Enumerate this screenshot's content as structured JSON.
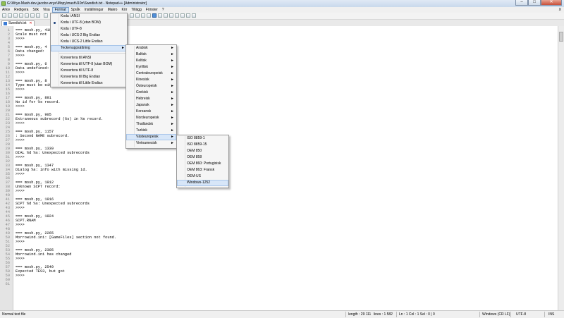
{
  "window": {
    "title": "G:\\Wrye-Mash-dev-jacobv-wrye\\Mopy\\mash\\l10n\\Swedish.txt - Notepad++ [Administrator]"
  },
  "menubar": [
    "Arkiv",
    "Redigera",
    "Sök",
    "Visa",
    "Format",
    "Språk",
    "Inställningar",
    "Makro",
    "Kör",
    "Tillägg",
    "Fönster",
    "?"
  ],
  "menubar_close": "X",
  "tab": {
    "label": "Swedish.txt"
  },
  "format_menu": {
    "items": [
      "Koda i ANSI",
      "Koda i UTF-8 (utan BOM)",
      "Koda i UTF-8",
      "Koda i UCS-2 Big Endian",
      "Koda i UCS-2 Little Endian"
    ],
    "selected_index": 1,
    "submenu_item": "Teckenuppsättning",
    "convert_items": [
      "Konvertera till ANSI",
      "Konvertera till UTF-8 (utan BOM)",
      "Konvertera till UTF-8",
      "Konvertera till Big Endian",
      "Konvertera till Little Endian"
    ]
  },
  "charset_menu": {
    "items": [
      "Arabisk",
      "Baltisk",
      "Keltisk",
      "Kyrillisk",
      "Centraleuropeisk",
      "Kinesisk",
      "Östeuropeisk",
      "Grekisk",
      "Hebreisk",
      "Japansk",
      "Koreansk",
      "Nordeuropeisk",
      "Thailändsk",
      "Turkisk",
      "Västeuropeisk",
      "Vietnamesisk"
    ],
    "highlighted": "Västeuropeisk"
  },
  "west_menu": {
    "items": [
      "ISO 8859-1",
      "ISO 8859-15",
      "OEM 850",
      "OEM 858",
      "OEM 860: Portugisisk",
      "OEM 863: Fransk",
      "OEM-US",
      "Windows-1252"
    ],
    "highlighted": "Windows-1252"
  },
  "editor": {
    "lines": [
      {
        "n": "1",
        "t": "=== mosh.py, 410"
      },
      {
        "n": "2",
        "t": "Scale must not"
      },
      {
        "n": "3",
        "t": ">>>>"
      },
      {
        "n": "4",
        "t": ""
      },
      {
        "n": "5",
        "t": "=== mosh.py, 4"
      },
      {
        "n": "6",
        "t": "Data changed:"
      },
      {
        "n": "7",
        "t": ">>>>"
      },
      {
        "n": "8",
        "t": ""
      },
      {
        "n": "9",
        "t": "=== mosh.py, 6"
      },
      {
        "n": "10",
        "t": "Data undefined:"
      },
      {
        "n": "11",
        "t": ">>>>"
      },
      {
        "n": "12",
        "t": ""
      },
      {
        "n": "13",
        "t": "=== mosh.py, 8"
      },
      {
        "n": "14",
        "t": "Type must be either LEVC or LEVI."
      },
      {
        "n": "15",
        "t": ">>>>"
      },
      {
        "n": "16",
        "t": ""
      },
      {
        "n": "17",
        "t": "=== mosh.py, 891"
      },
      {
        "n": "18",
        "t": "No id for %s record."
      },
      {
        "n": "19",
        "t": ">>>>"
      },
      {
        "n": "20",
        "t": ""
      },
      {
        "n": "21",
        "t": "=== mosh.py, 905"
      },
      {
        "n": "22",
        "t": "Extraneous subrecord (%s) in %s record."
      },
      {
        "n": "23",
        "t": ">>>>"
      },
      {
        "n": "24",
        "t": ""
      },
      {
        "n": "25",
        "t": "=== mosh.py, 1157"
      },
      {
        "n": "26",
        "t": ": Second NAME subrecord."
      },
      {
        "n": "27",
        "t": ">>>>"
      },
      {
        "n": "28",
        "t": ""
      },
      {
        "n": "29",
        "t": "=== mosh.py, 1339"
      },
      {
        "n": "30",
        "t": "DIAL %d %s: Unexpected subrecords"
      },
      {
        "n": "31",
        "t": ">>>>"
      },
      {
        "n": "32",
        "t": ""
      },
      {
        "n": "33",
        "t": "=== mosh.py, 1347"
      },
      {
        "n": "34",
        "t": "Dialog %s: info with missing id."
      },
      {
        "n": "35",
        "t": ">>>>"
      },
      {
        "n": "36",
        "t": ""
      },
      {
        "n": "37",
        "t": "=== mosh.py, 1912"
      },
      {
        "n": "38",
        "t": "Unknown SCPT record:"
      },
      {
        "n": "39",
        "t": ">>>>"
      },
      {
        "n": "40",
        "t": ""
      },
      {
        "n": "41",
        "t": "=== mosh.py, 1916"
      },
      {
        "n": "42",
        "t": "SCPT %d %s: Unexpected subrecords"
      },
      {
        "n": "43",
        "t": ">>>>"
      },
      {
        "n": "44",
        "t": ""
      },
      {
        "n": "45",
        "t": "=== mosh.py, 1924"
      },
      {
        "n": "46",
        "t": "SCPT.RNAM"
      },
      {
        "n": "47",
        "t": ">>>>"
      },
      {
        "n": "48",
        "t": ""
      },
      {
        "n": "49",
        "t": "=== mosh.py, 2265"
      },
      {
        "n": "50",
        "t": "Morrowind.ini: [GameFiles] section not found."
      },
      {
        "n": "51",
        "t": ">>>>"
      },
      {
        "n": "52",
        "t": ""
      },
      {
        "n": "53",
        "t": "=== mosh.py, 2305"
      },
      {
        "n": "54",
        "t": "Morrowind.ini has changed"
      },
      {
        "n": "55",
        "t": ">>>>"
      },
      {
        "n": "56",
        "t": ""
      },
      {
        "n": "57",
        "t": "=== mosh.py, 2549"
      },
      {
        "n": "58",
        "t": "Expected TES3, but got"
      },
      {
        "n": "59",
        "t": ">>>>"
      },
      {
        "n": "60",
        "t": ""
      },
      {
        "n": "61",
        "t": ""
      }
    ]
  },
  "status": {
    "type": "Normal text file",
    "length": "length : 29 111",
    "lines": "lines : 1 582",
    "pos": "Ln : 1   Col : 1   Sel : 0 | 0",
    "eol": "Windows (CR LF)",
    "enc": "UTF-8",
    "ins": "INS"
  },
  "colors": {
    "accent": "#cde1f7",
    "highlight": "#d7e6f8"
  }
}
